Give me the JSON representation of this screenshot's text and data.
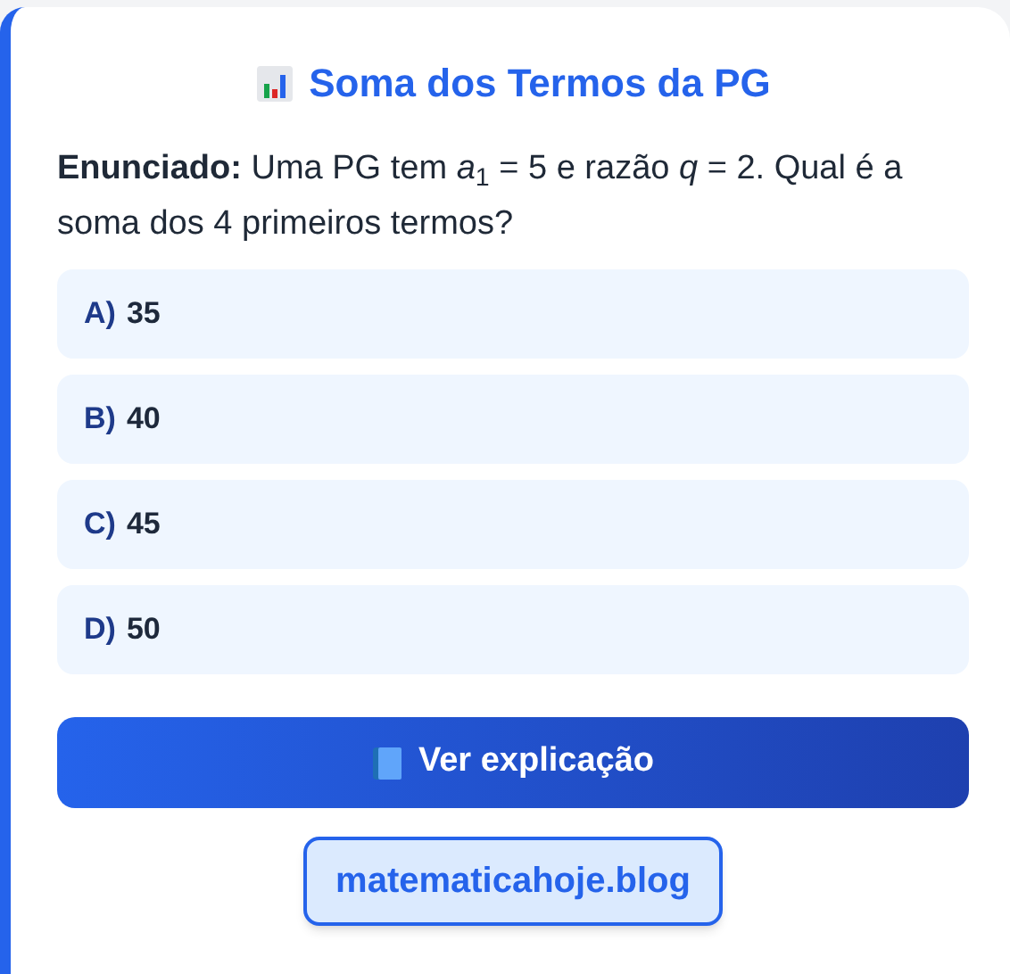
{
  "title": "Soma dos Termos da PG",
  "statement": "**Enunciado:** Uma PG tem *a*$_{1}$ = 5 e razão *q* = 2. Qual é a soma dos 4 primeiros termos?",
  "options": [
    {
      "letter": "A)",
      "value": "35"
    },
    {
      "letter": "B)",
      "value": "40"
    },
    {
      "letter": "C)",
      "value": "45"
    },
    {
      "letter": "D)",
      "value": "50"
    }
  ],
  "button": "Ver explicação",
  "link": "matematicahoje.blog"
}
